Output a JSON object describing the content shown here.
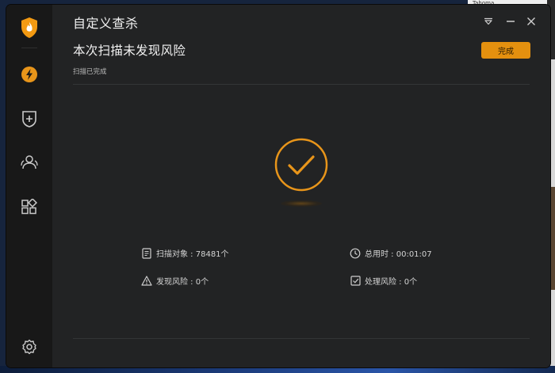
{
  "window": {
    "title": "自定义查杀",
    "headline": "本次扫描未发现风险",
    "subline": "扫描已完成",
    "done_button": "完成"
  },
  "sidebar": {
    "items": [
      {
        "icon": "logo-shield-icon"
      },
      {
        "icon": "lightning-icon"
      },
      {
        "icon": "shield-plus-icon"
      },
      {
        "icon": "users-icon"
      },
      {
        "icon": "apps-grid-icon"
      },
      {
        "icon": "gear-icon"
      }
    ]
  },
  "controls": {
    "icons": [
      "dropdown-menu-icon",
      "minimize-icon",
      "close-icon"
    ]
  },
  "stats": {
    "scan_objects": "扫描对象 : 78481个",
    "total_time": "总用时 : 00:01:07",
    "risks_found": "发现风险 : 0个",
    "risks_handled": "处理风险 : 0个"
  },
  "background": {
    "font_box_label": "Tahoma"
  },
  "colors": {
    "accent": "#e4900f",
    "window_bg": "#222324",
    "sidebar_bg": "#181818"
  }
}
